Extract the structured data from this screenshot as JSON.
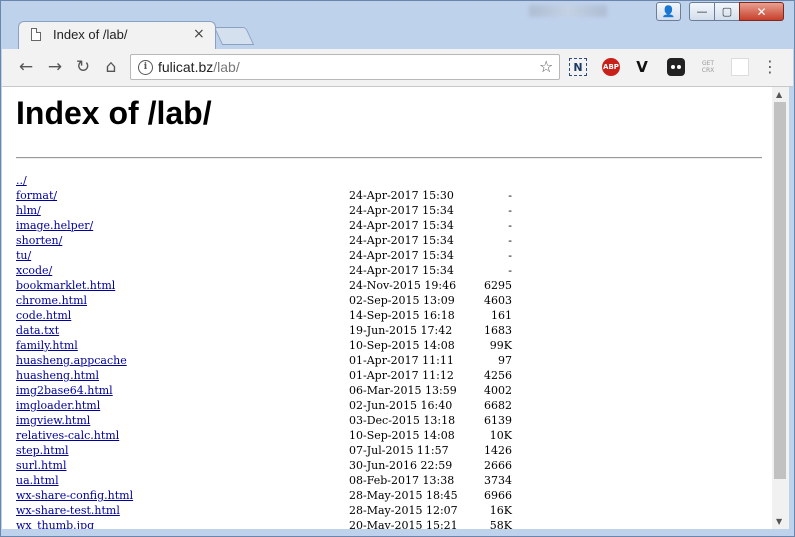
{
  "tab": {
    "title": "Index of /lab/",
    "close": "×"
  },
  "window": {
    "close": "✕",
    "maximize": "▢",
    "minimize": "—"
  },
  "address": {
    "host": "fulicat.bz",
    "path": "/lab/"
  },
  "extensions": {
    "n_label": "N",
    "abp_label": "ABP",
    "v_label": "V",
    "crx_top": "GET",
    "crx_bottom": "CRX"
  },
  "page": {
    "title": "Index of /lab/",
    "entries": [
      {
        "name": "../",
        "date": "",
        "size": ""
      },
      {
        "name": "format/",
        "date": "24-Apr-2017 15:30",
        "size": "-"
      },
      {
        "name": "hlm/",
        "date": "24-Apr-2017 15:34",
        "size": "-"
      },
      {
        "name": "image.helper/",
        "date": "24-Apr-2017 15:34",
        "size": "-"
      },
      {
        "name": "shorten/",
        "date": "24-Apr-2017 15:34",
        "size": "-"
      },
      {
        "name": "tu/",
        "date": "24-Apr-2017 15:34",
        "size": "-"
      },
      {
        "name": "xcode/",
        "date": "24-Apr-2017 15:34",
        "size": "-"
      },
      {
        "name": "bookmarklet.html",
        "date": "24-Nov-2015 19:46",
        "size": "6295"
      },
      {
        "name": "chrome.html",
        "date": "02-Sep-2015 13:09",
        "size": "4603"
      },
      {
        "name": "code.html",
        "date": "14-Sep-2015 16:18",
        "size": "161"
      },
      {
        "name": "data.txt",
        "date": "19-Jun-2015 17:42",
        "size": "1683"
      },
      {
        "name": "family.html",
        "date": "10-Sep-2015 14:08",
        "size": "99K"
      },
      {
        "name": "huasheng.appcache",
        "date": "01-Apr-2017 11:11",
        "size": "97"
      },
      {
        "name": "huasheng.html",
        "date": "01-Apr-2017 11:12",
        "size": "4256"
      },
      {
        "name": "img2base64.html",
        "date": "06-Mar-2015 13:59",
        "size": "4002"
      },
      {
        "name": "imgloader.html",
        "date": "02-Jun-2015 16:40",
        "size": "6682"
      },
      {
        "name": "imgview.html",
        "date": "03-Dec-2015 13:18",
        "size": "6139"
      },
      {
        "name": "relatives-calc.html",
        "date": "10-Sep-2015 14:08",
        "size": "10K"
      },
      {
        "name": "step.html",
        "date": "07-Jul-2015 11:57",
        "size": "1426"
      },
      {
        "name": "surl.html",
        "date": "30-Jun-2016 22:59",
        "size": "2666"
      },
      {
        "name": "ua.html",
        "date": "08-Feb-2017 13:38",
        "size": "3734"
      },
      {
        "name": "wx-share-config.html",
        "date": "28-May-2015 18:45",
        "size": "6966"
      },
      {
        "name": "wx-share-test.html",
        "date": "28-May-2015 12:07",
        "size": "16K"
      },
      {
        "name": "wx_thumb.jpg",
        "date": "20-May-2015 15:21",
        "size": "58K"
      }
    ]
  }
}
